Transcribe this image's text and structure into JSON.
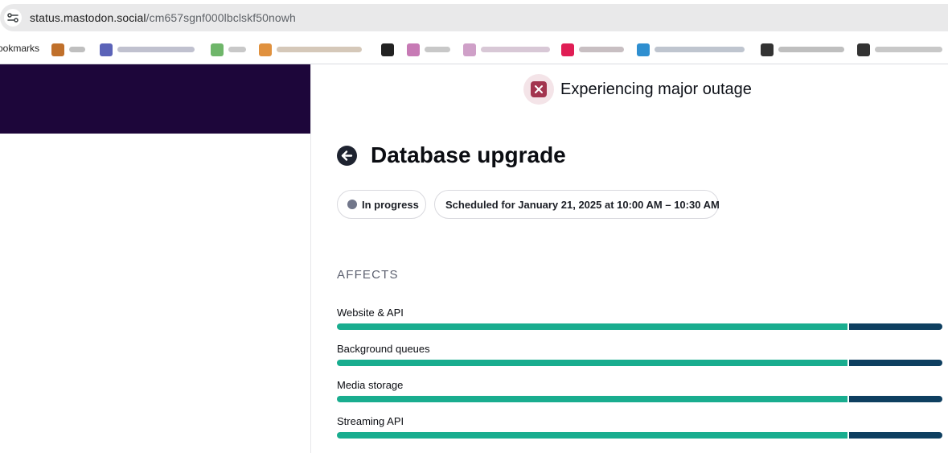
{
  "browser": {
    "url_host": "status.mastodon.social",
    "url_path": "/cm657sgnf000lbclskf50nowh",
    "bookmarks_label": "ookmarks"
  },
  "banner": {
    "status_text": "Experiencing major outage",
    "status_icon": "close-icon",
    "status_color": "#a3354f"
  },
  "incident": {
    "title": "Database upgrade",
    "back_icon": "arrow-left-icon",
    "status_label": "In progress",
    "schedule_label": "Scheduled for January 21, 2025 at 10:00 AM – 10:30 AM"
  },
  "affects": {
    "heading": "AFFECTS",
    "colors": {
      "operational": "#19ad8f",
      "maintenance": "#0e3f60"
    },
    "components": [
      {
        "name": "Website & API",
        "maintenance_fraction": 0.155
      },
      {
        "name": "Background queues",
        "maintenance_fraction": 0.155
      },
      {
        "name": "Media storage",
        "maintenance_fraction": 0.155
      },
      {
        "name": "Streaming API",
        "maintenance_fraction": 0.155
      }
    ]
  }
}
